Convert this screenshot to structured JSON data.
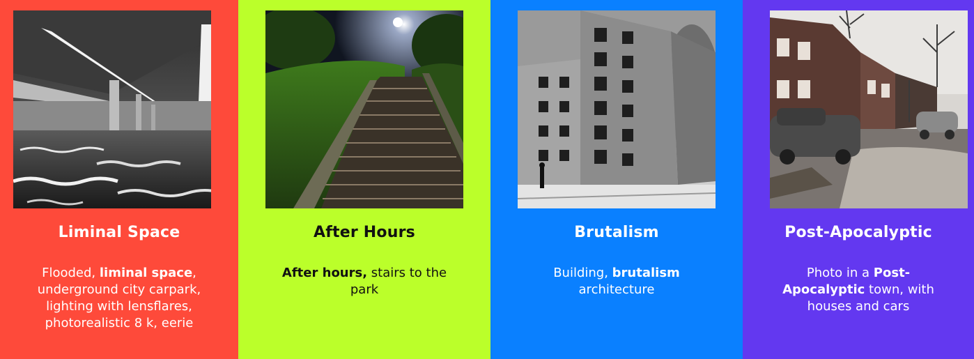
{
  "cards": [
    {
      "title": "Liminal Space",
      "desc": {
        "pre": "Flooded, ",
        "bold": "liminal space",
        "post": ", underground city carpark, lighting with lensflares, photorealistic 8 k, eerie"
      },
      "background": "#FE4A3A"
    },
    {
      "title": "After Hours",
      "desc": {
        "pre": "",
        "bold": "After hours,",
        "post": " stairs to the park"
      },
      "background": "#BBFF2A"
    },
    {
      "title": "Brutalism",
      "desc": {
        "pre": "Building, ",
        "bold": "brutalism",
        "post": " architecture"
      },
      "background": "#0A80FF"
    },
    {
      "title": "Post-Apocalyptic",
      "desc": {
        "pre": "Photo in a ",
        "bold": "Post-Apocalyptic",
        "post": " town, with houses and cars"
      },
      "background": "#6338F0"
    }
  ]
}
